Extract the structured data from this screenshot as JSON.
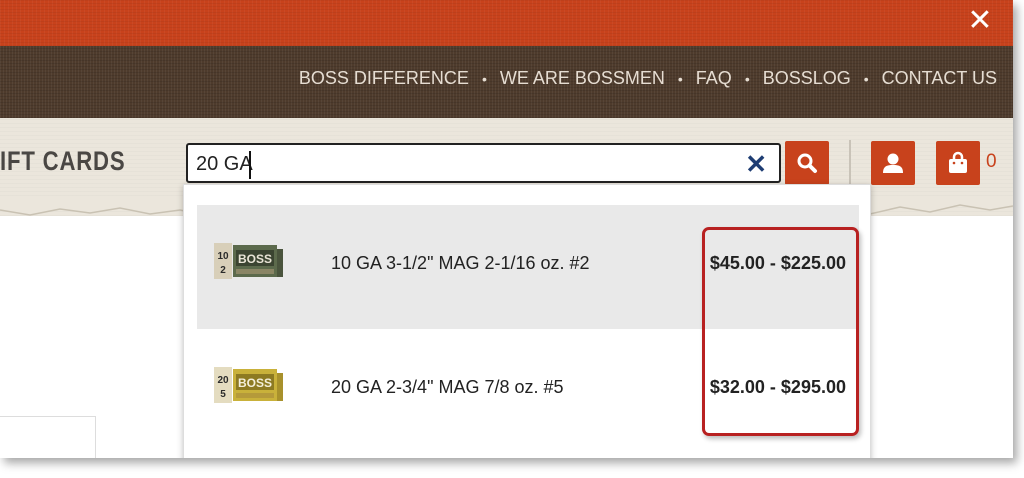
{
  "topbar": {
    "close_icon": "close-icon"
  },
  "nav": {
    "links": [
      "BOSS DIFFERENCE",
      "WE ARE BOSSMEN",
      "FAQ",
      "BOSSLOG",
      "CONTACT US"
    ],
    "separator": "•"
  },
  "header": {
    "partial_menu_label": "IFT CARDS",
    "search": {
      "value": "20 GA",
      "clear_icon": "close-icon",
      "button_icon": "search-icon"
    },
    "account_icon": "user-icon",
    "cart": {
      "icon": "shopping-bag-icon",
      "count": "0"
    }
  },
  "search_results": [
    {
      "name": "10 GA 3-1/2\" MAG 2-1/16 oz. #2",
      "price": "$45.00 - $225.00",
      "thumb_label": "10\n2",
      "highlighted": true
    },
    {
      "name": "20 GA 2-3/4\" MAG 7/8 oz. #5",
      "price": "$32.00 - $295.00",
      "thumb_label": "20\n5",
      "highlighted": false
    }
  ],
  "colors": {
    "brand_red": "#c8421c",
    "nav_brown": "#4e3b2c",
    "annotation_red": "#b82121",
    "clear_icon_blue": "#1e3d73"
  }
}
